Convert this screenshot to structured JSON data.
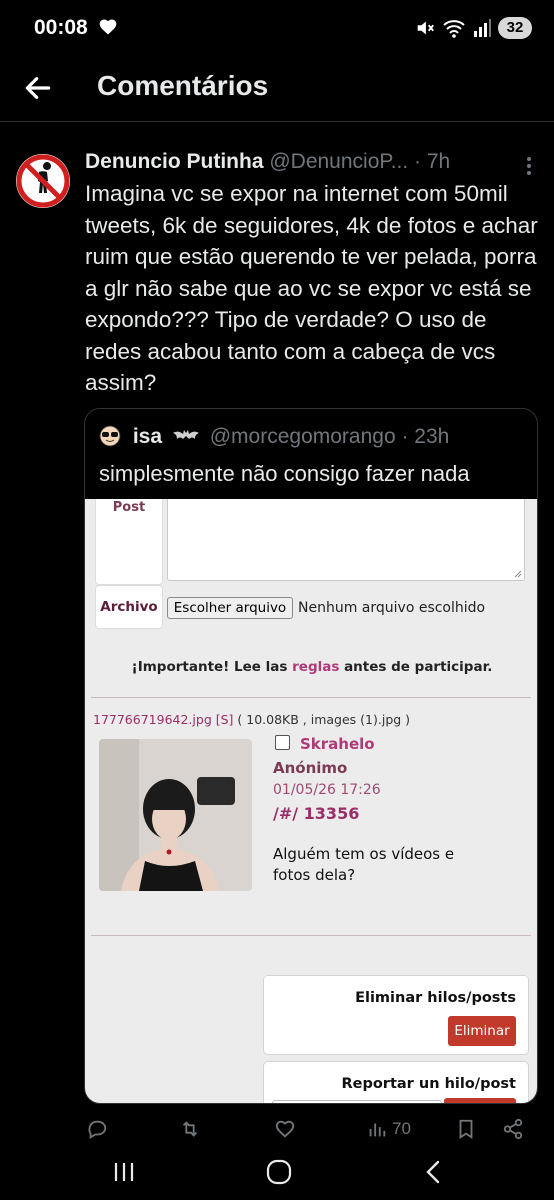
{
  "status_bar": {
    "time": "00:08",
    "battery": "32",
    "icons": [
      "heart-icon",
      "mute-icon",
      "wifi-icon",
      "signal-icon"
    ]
  },
  "header": {
    "title": "Comentários",
    "back_icon": "arrow-left-icon"
  },
  "tweet": {
    "author_name": "Denuncio Putinha",
    "author_handle": "@DenuncioP...",
    "age": "· 7h",
    "text": "Imagina vc se expor na internet com 50mil tweets, 6k de seguidores, 4k de fotos e achar ruim que estão querendo te ver pelada, porra a glr não sabe que ao vc se expor vc está se expondo??? Tipo de verdade? O uso de redes acabou tanto com a cabeça de vcs assim?"
  },
  "quote": {
    "author_name": "isa",
    "author_handle": "@morcegomorango",
    "age": "· 23h",
    "text": "simplesmente não consigo fazer nada",
    "image": {
      "post_label": "Post",
      "archivo_label": "Archivo",
      "choose_file": "Escolher arquivo",
      "no_file": "Nenhum arquivo escolhido",
      "important_prefix": "¡Importante! Lee las ",
      "important_link": "reglas",
      "important_suffix": " antes de participar.",
      "file_name": "177766719642.jpg",
      "file_flag": "[S]",
      "file_meta": "( 10.08KB , images (1).jpg )",
      "subject": "Skrahelo",
      "poster": "Anónimo",
      "date": "01/05/26 17:26",
      "post_number": "/#/ 13356",
      "body": "Alguém tem os vídeos e fotos dela?",
      "delete_title": "Eliminar hilos/posts",
      "delete_button": "Eliminar",
      "report_title": "Reportar un hilo/post"
    }
  },
  "actions": {
    "views": "70"
  },
  "colors": {
    "background": "#000000",
    "text": "#e7e9ea",
    "muted": "#71767b",
    "border": "#2f3336",
    "board_accent": "#b03a78",
    "button_red": "#c0392b"
  }
}
